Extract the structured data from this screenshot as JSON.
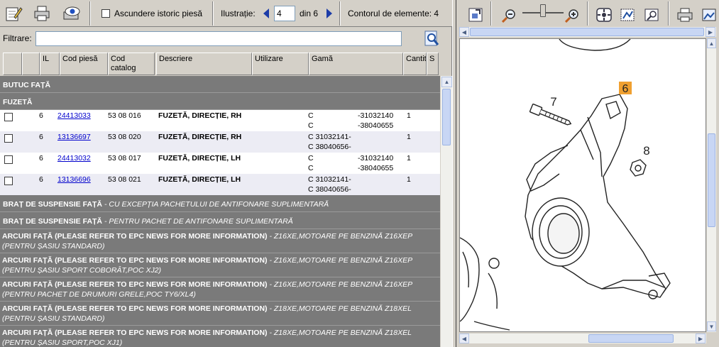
{
  "toolbar": {
    "hide_history_label": "Ascundere istoric piesă",
    "illustration_label": "Ilustrație:",
    "illustration_value": "4",
    "of_label": "din 6",
    "element_outline_label": "Contorul de elemente: 4"
  },
  "filter": {
    "label": "Filtrare:",
    "value": ""
  },
  "columns": [
    "IL",
    "Cod piesă",
    "Cod catalog",
    "Descriere",
    "Utilizare",
    "Gamă",
    "Cantit",
    "S"
  ],
  "groups": {
    "g1": "BUTUC FAȚĂ",
    "g2": "FUZETĂ",
    "g3_bold": "BRAȚ DE SUSPENSIE FAȚĂ",
    "g3_italic": " - CU EXCEPȚIA PACHETULUI DE ANTIFONARE SUPLIMENTARĂ",
    "g4_bold": "BRAȚ DE SUSPENSIE FAȚĂ",
    "g4_italic": " - PENTRU PACHET DE ANTIFONARE SUPLIMENTARĂ",
    "g5_bold": "ARCURI FAȚĂ (PLEASE REFER TO EPC NEWS FOR MORE INFORMATION)",
    "g5_italic": " - Z16XE,MOTOARE PE BENZINĂ Z16XEP (PENTRU ȘASIU STANDARD)",
    "g6_bold": "ARCURI FAȚĂ (PLEASE REFER TO EPC NEWS FOR MORE INFORMATION)",
    "g6_italic": " - Z16XE,MOTOARE PE BENZINĂ Z16XEP (PENTRU ȘASIU SPORT COBORÂT,POC XJ2)",
    "g7_bold": "ARCURI FAȚĂ (PLEASE REFER TO EPC NEWS FOR MORE INFORMATION)",
    "g7_italic": " - Z16XE,MOTOARE PE BENZINĂ Z16XEP (PENTRU PACHET DE DRUMURI GRELE,POC TY6/XL4)",
    "g8_bold": "ARCURI FAȚĂ (PLEASE REFER TO EPC NEWS FOR MORE INFORMATION)",
    "g8_italic": " - Z18XE,MOTOARE PE BENZINĂ Z18XEL (PENTRU ȘASIU STANDARD)",
    "g9_bold": "ARCURI FAȚĂ (PLEASE REFER TO EPC NEWS FOR MORE INFORMATION)",
    "g9_italic": " - Z18XE,MOTOARE PE BENZINĂ Z18XEL (PENTRU ȘASIU SPORT,POC XJ1)"
  },
  "rows": [
    {
      "il": "6",
      "part": "24413033",
      "catalog": "53 08 016",
      "desc": "FUZETĂ, DIRECȚIE, RH",
      "range1": "C",
      "range2": "C",
      "range3": "-31032140",
      "range4": "-38040655",
      "qty": "1"
    },
    {
      "il": "6",
      "part": "13136697",
      "catalog": "53 08 020",
      "desc": "FUZETĂ, DIRECȚIE, RH",
      "range1": "C 31032141-",
      "range2": "C 38040656-",
      "range3": "",
      "range4": "",
      "qty": "1"
    },
    {
      "il": "6",
      "part": "24413032",
      "catalog": "53 08 017",
      "desc": "FUZETĂ, DIRECȚIE, LH",
      "range1": "C",
      "range2": "C",
      "range3": "-31032140",
      "range4": "-38040655",
      "qty": "1"
    },
    {
      "il": "6",
      "part": "13136696",
      "catalog": "53 08 021",
      "desc": "FUZETĂ, DIRECȚIE, LH",
      "range1": "C 31032141-",
      "range2": "C 38040656-",
      "range3": "",
      "range4": "",
      "qty": "1"
    }
  ],
  "diagram": {
    "callout_6": "6",
    "callout_7": "7",
    "callout_8": "8",
    "highlight_color": "#f0a030"
  }
}
